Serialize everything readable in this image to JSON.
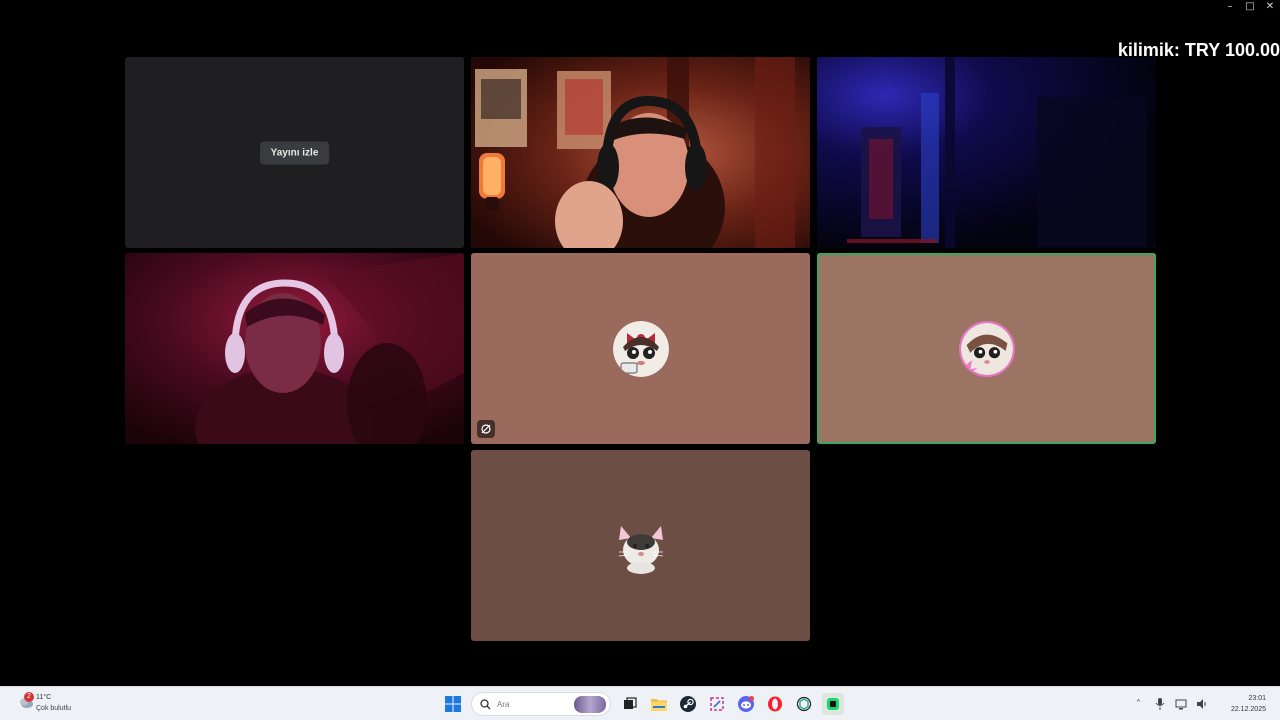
{
  "window": {
    "controls": [
      "minimize",
      "maximize",
      "close"
    ]
  },
  "overlay": {
    "donation_text": "kilimik: TRY 100.00"
  },
  "grid": {
    "stream_tile": {
      "button_label": "Yayını izle"
    },
    "tiles": [
      {
        "id": "stream",
        "type": "stream-preview"
      },
      {
        "id": "cam1",
        "type": "camera",
        "speaking": true
      },
      {
        "id": "cam2",
        "type": "camera",
        "speaking": true
      },
      {
        "id": "cam3",
        "type": "camera",
        "speaking": false
      },
      {
        "id": "user1",
        "type": "avatar",
        "avatar": "bow-girl-avatar",
        "muted": true,
        "bg": "#9a6a5c"
      },
      {
        "id": "user2",
        "type": "avatar",
        "avatar": "pink-girl-avatar",
        "speaking": true,
        "bg": "#9c7463"
      },
      {
        "id": "user3",
        "type": "avatar",
        "avatar": "cat-avatar",
        "bg": "#6d4e44"
      }
    ]
  },
  "taskbar": {
    "weather": {
      "badge": "2",
      "temp": "11°C",
      "condition": "Çok bulutlu"
    },
    "search": {
      "placeholder": "Ara"
    },
    "pinned": [
      "windows-start-icon",
      "search-icon",
      "task-view-icon",
      "file-explorer-icon",
      "steam-icon",
      "snipping-tool-icon",
      "discord-icon",
      "opera-icon",
      "chatgpt-icon",
      "app-green-icon"
    ],
    "tray": [
      "chevron-up-icon",
      "microphone-icon",
      "network-icon",
      "volume-icon"
    ],
    "clock": {
      "time": "23:01",
      "date": "22.12.2025"
    }
  },
  "colors": {
    "speaking_outline": "#3ba55d",
    "taskbar_bg": "#eef1f5",
    "stream_tile_bg": "#1f1f21"
  }
}
